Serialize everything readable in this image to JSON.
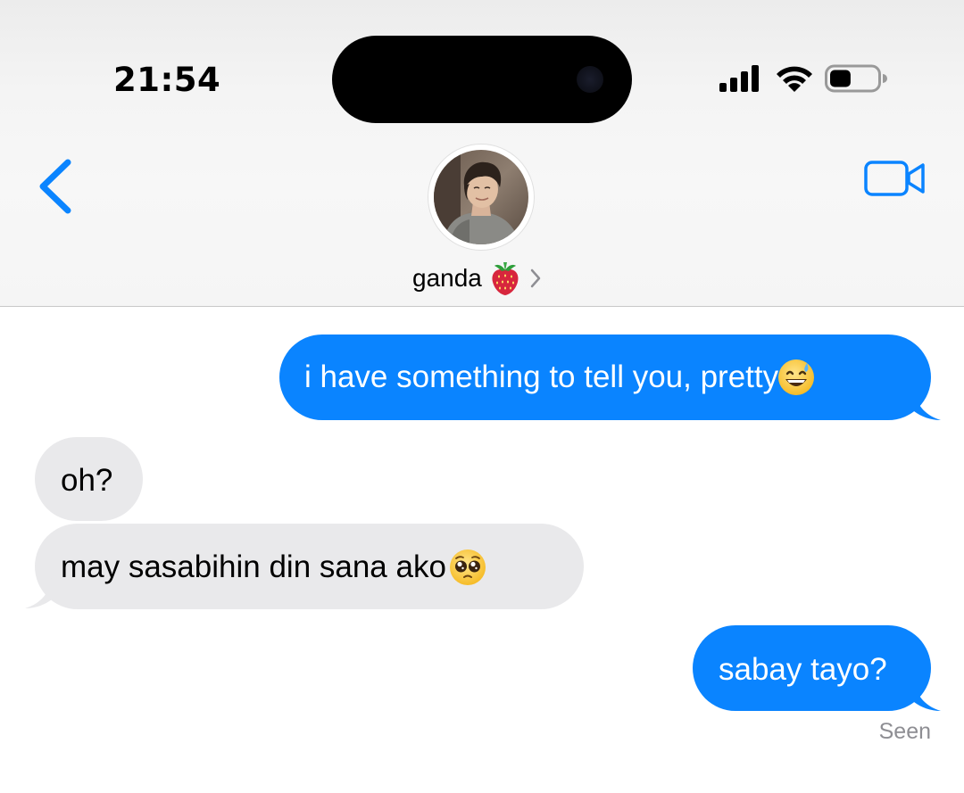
{
  "status_bar": {
    "time": "21:54",
    "signal_icon": "cellular-signal-icon",
    "wifi_icon": "wifi-icon",
    "battery_icon": "battery-icon",
    "battery_level": 0.45
  },
  "nav": {
    "back_icon": "chevron-left-icon",
    "video_icon": "video-camera-icon",
    "contact_name": "ganda",
    "contact_emoji": "strawberry",
    "contact_chevron": "chevron-right-icon",
    "accent_color": "#0a84ff"
  },
  "messages": [
    {
      "direction": "sent",
      "text": "i have something to tell you, pretty",
      "emoji": "grinning-face-with-sweat"
    },
    {
      "direction": "received",
      "text": "oh?"
    },
    {
      "direction": "received",
      "text": "may sasabihin din sana ako ",
      "emoji": "pleading-face"
    },
    {
      "direction": "sent",
      "text": "sabay tayo?"
    }
  ],
  "read_receipt": "Seen",
  "colors": {
    "sent_bubble": "#0a84ff",
    "received_bubble": "#e9e9eb",
    "receipt_text": "#8e8e93"
  }
}
